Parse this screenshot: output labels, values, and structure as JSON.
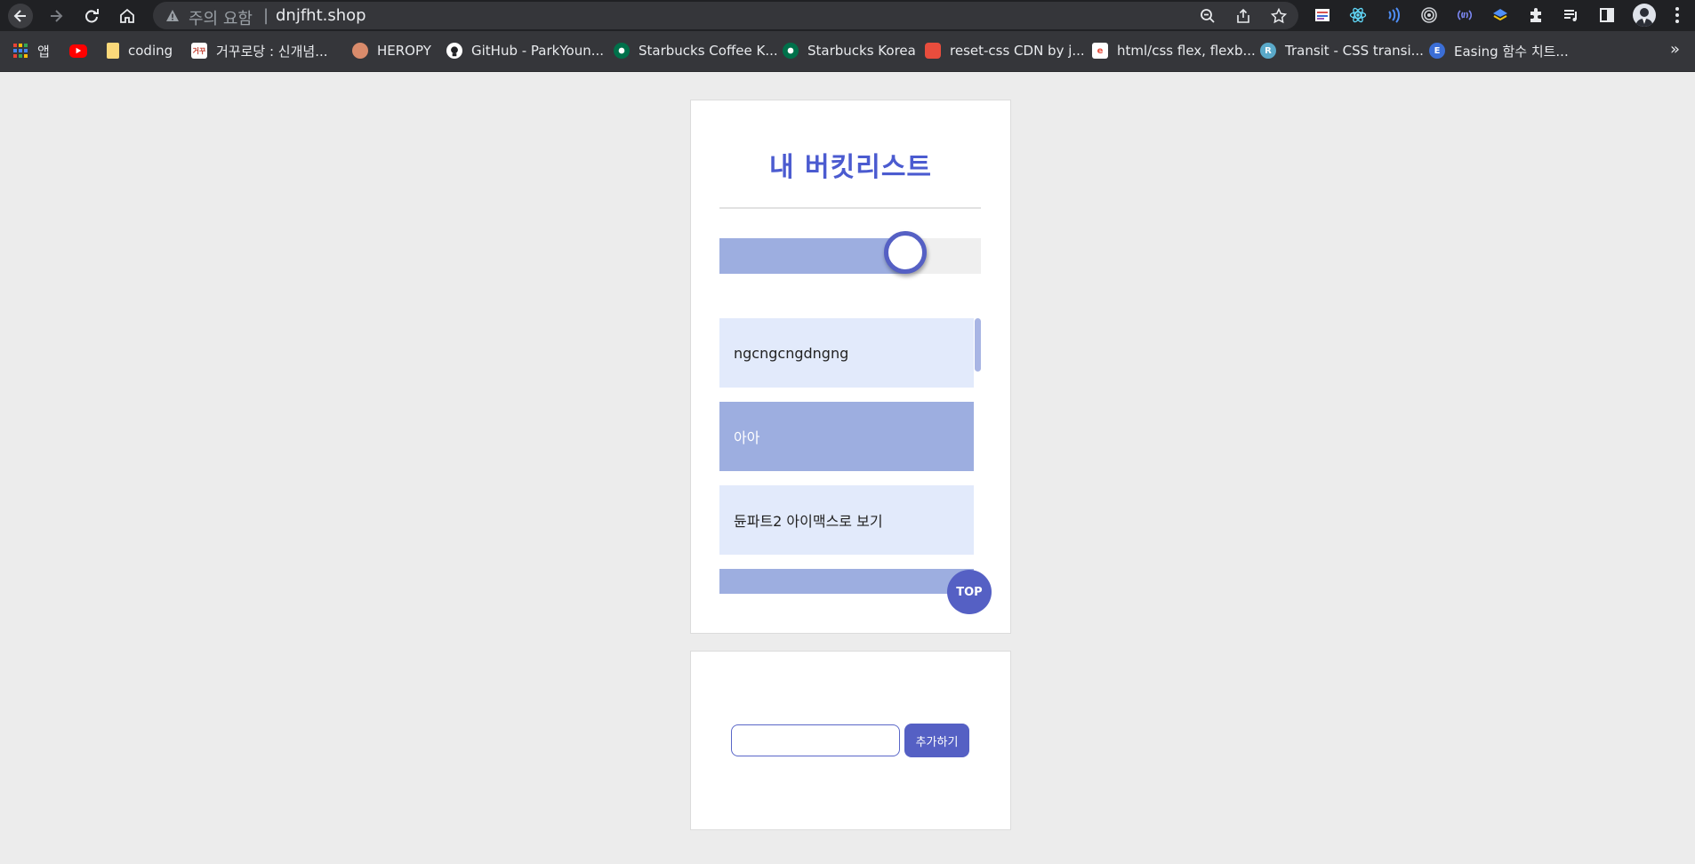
{
  "browser": {
    "security_label": "주의 요함",
    "url": "dnjfht.shop"
  },
  "bookmarks": {
    "items": [
      {
        "label": "앱",
        "icon": "apps-grid-icon"
      },
      {
        "label": "",
        "icon": "youtube-icon"
      },
      {
        "label": "coding",
        "icon": "folder-icon"
      },
      {
        "label": "거꾸로당 : 신개념...",
        "icon": "site-favicon-icon"
      },
      {
        "label": "HEROPY",
        "icon": "heropy-icon"
      },
      {
        "label": "GitHub - ParkYoun...",
        "icon": "github-icon"
      },
      {
        "label": "Starbucks Coffee K...",
        "icon": "starbucks-icon"
      },
      {
        "label": "Starbucks Korea",
        "icon": "starbucks-icon"
      },
      {
        "label": "reset-css CDN by j...",
        "icon": "jsdelivr-icon"
      },
      {
        "label": "html/css flex, flexb...",
        "icon": "site-favicon-icon"
      },
      {
        "label": "Transit - CSS transi...",
        "icon": "transit-icon"
      },
      {
        "label": "Easing 함수 치트...",
        "icon": "easing-icon"
      }
    ],
    "more": "»"
  },
  "page": {
    "title": "내 버킷리스트",
    "progress_fraction": 0.71,
    "items": [
      {
        "text": "ngcngcngdngng",
        "style": "light"
      },
      {
        "text": "아아",
        "style": "dark"
      },
      {
        "text": "듄파트2 아이맥스로 보기",
        "style": "light"
      },
      {
        "text": "",
        "style": "dark"
      }
    ],
    "top_button": "TOP",
    "add_button": "추가하기",
    "input_value": ""
  },
  "colors": {
    "accent": "#5560c4",
    "title": "#4b5bd0",
    "item_light": "#e2eafb",
    "item_dark": "#9daee0",
    "background": "#ececec"
  }
}
